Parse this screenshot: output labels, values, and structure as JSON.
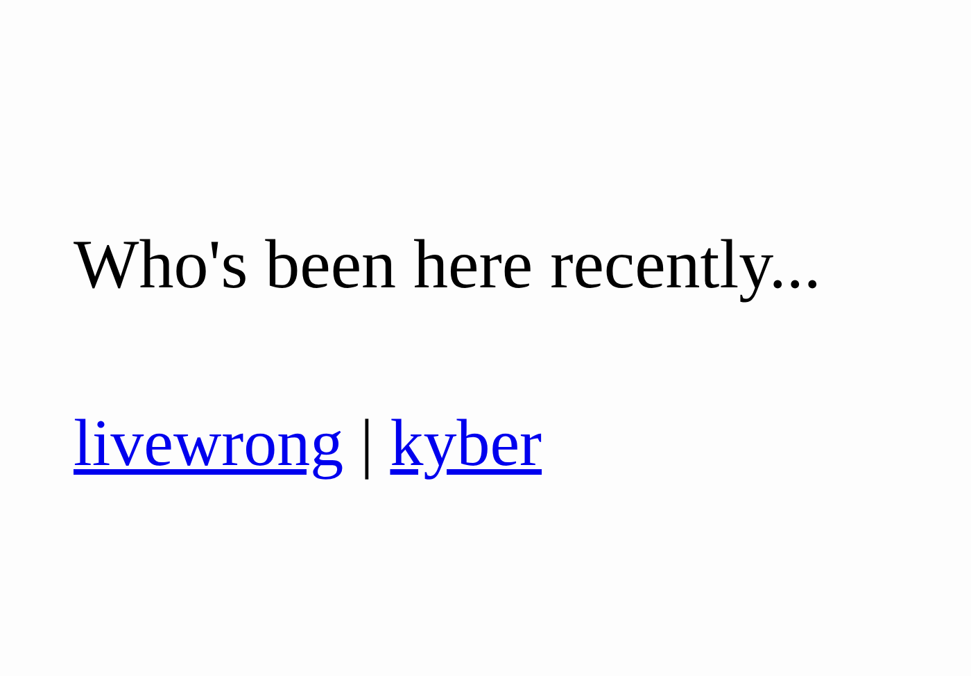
{
  "heading": "Who's been here recently...",
  "links": [
    {
      "label": "livewrong"
    },
    {
      "label": "kyber"
    }
  ],
  "separator": "|"
}
